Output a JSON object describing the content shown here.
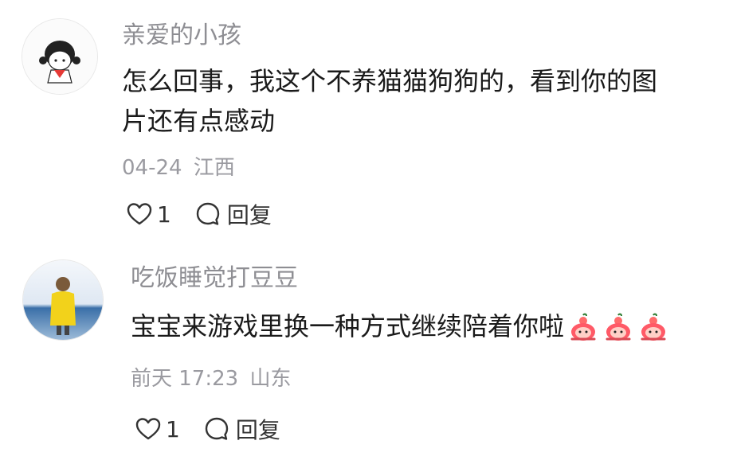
{
  "comments": [
    {
      "username": "亲爱的小孩",
      "text_line1": "怎么回事，我这个不养猫猫狗狗的，看到你的图",
      "text_line2": "片还有点感动",
      "date": "04-24",
      "location": "江西",
      "like_count": "1",
      "reply_label": "回复",
      "avatar_icon": "cartoon-girl-avatar"
    },
    {
      "username": "吃饭睡觉打豆豆",
      "text": "宝宝来游戏里换一种方式继续陪着你啦",
      "emoji_icon": "pink-peach-emoji",
      "emoji_count": 3,
      "date": "前天 17:23",
      "location": "山东",
      "like_count": "1",
      "reply_label": "回复",
      "avatar_icon": "photo-person-yellow-coat-avatar"
    }
  ],
  "colors": {
    "username": "#8e8e93",
    "text": "#1a1a1a",
    "meta": "#9a9aa0",
    "icon": "#333333"
  }
}
